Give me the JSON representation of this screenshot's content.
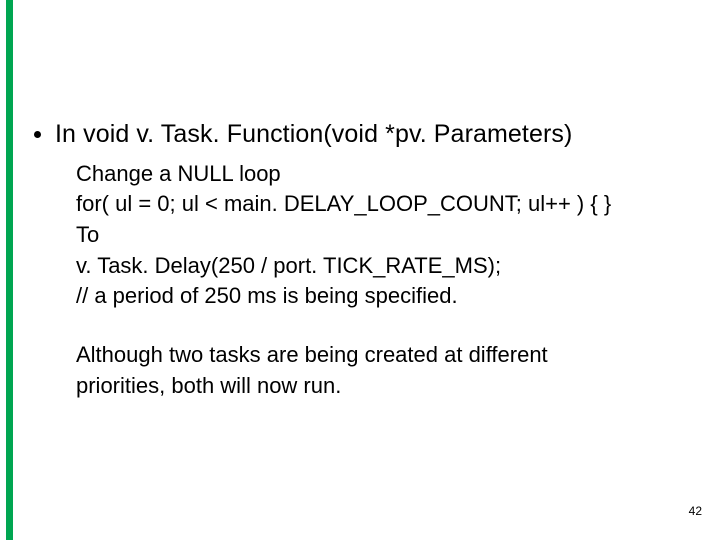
{
  "heading": {
    "prefix": "In ",
    "code": "void v. Task. Function(void *pv. Parameters)"
  },
  "body": {
    "line1": "Change a NULL loop",
    "line2": "for( ul = 0; ul < main. DELAY_LOOP_COUNT; ul++ ) { }",
    "line3": "To",
    "line4": "v. Task. Delay(250 / port. TICK_RATE_MS);",
    "line5": "// a period of 250 ms is being specified."
  },
  "note": {
    "line1": "Although two tasks are being created at different",
    "line2": "priorities, both will now run."
  },
  "page_number": "42"
}
